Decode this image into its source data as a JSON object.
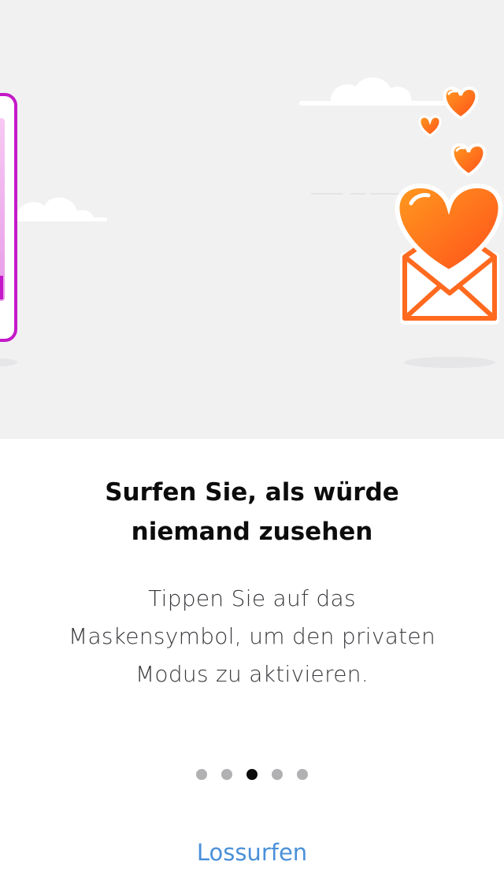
{
  "onboarding": {
    "title_line1": "Surfen Sie, als würde",
    "title_line2": "niemand zusehen",
    "body_line1": "Tippen Sie auf das",
    "body_line2": "Maskensymbol, um den privaten",
    "body_line3": "Modus zu aktivieren.",
    "pager": {
      "total": 5,
      "active_index": 2
    },
    "cta_label": "Lossurfen"
  },
  "colors": {
    "illustration_background": "#f1f1f2",
    "title_text": "#0c0c0d",
    "body_text": "#38383d",
    "dot_inactive": "#b1b1b3",
    "dot_active": "#0c0c0d",
    "cta_text": "#4a90d9",
    "heart_orange": "#ff7a1a",
    "envelope_orange": "#ff6a1f",
    "phone_frame_magenta": "#c419c8"
  },
  "illustration": {
    "icons": [
      "phone-frame-icon",
      "cloud-icon",
      "heart-icon",
      "envelope-icon"
    ]
  }
}
